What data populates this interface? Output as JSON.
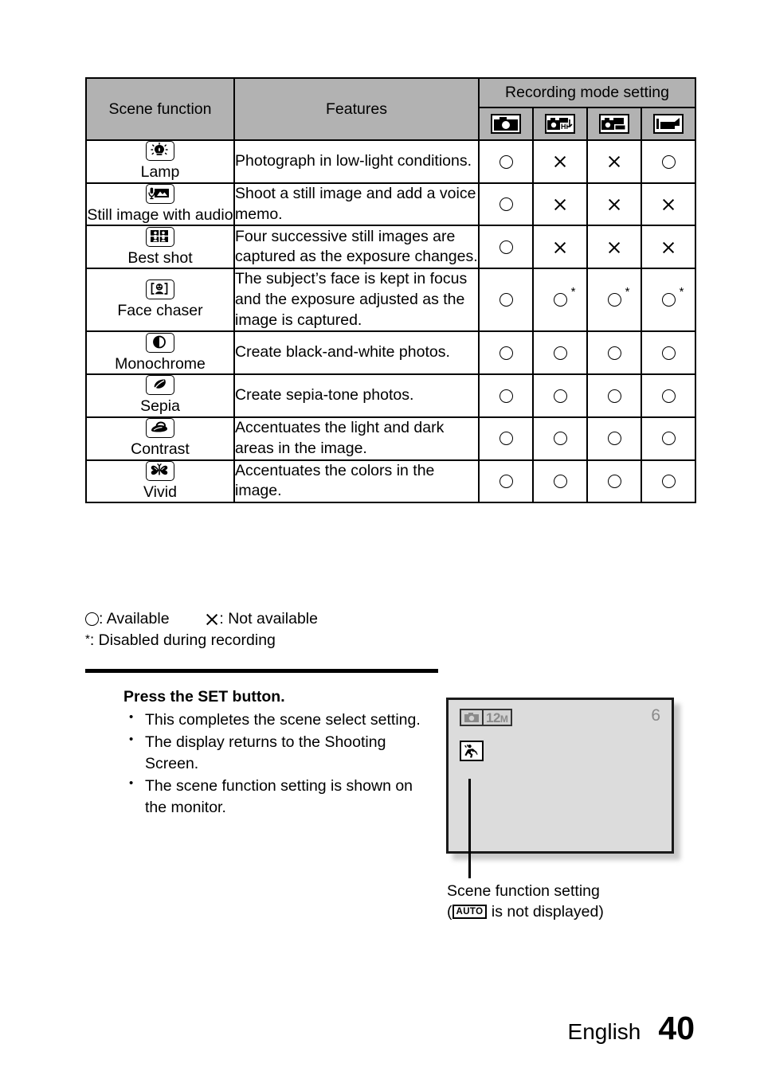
{
  "table": {
    "headers": {
      "scene_function": "Scene function",
      "features": "Features",
      "recording_mode_setting": "Recording mode setting"
    },
    "mode_icons": [
      {
        "name": "single-shot-camera-icon",
        "label": "single shot"
      },
      {
        "name": "high-speed-sequential-camera-icon",
        "label": "Hi sequential shots"
      },
      {
        "name": "sequential-shots-camera-icon",
        "label": "sequential shots"
      },
      {
        "name": "video-camera-icon",
        "label": "video"
      }
    ],
    "rows": [
      {
        "icon": "lamp-icon",
        "scene": "Lamp",
        "features": "Photograph in low-light conditions.",
        "marks": [
          "circle",
          "cross",
          "cross",
          "circle"
        ],
        "stars": [
          false,
          false,
          false,
          false
        ]
      },
      {
        "icon": "still-image-with-audio-icon",
        "scene": "Still image with audio",
        "features": "Shoot a still image and add a voice memo.",
        "marks": [
          "circle",
          "cross",
          "cross",
          "cross"
        ],
        "stars": [
          false,
          false,
          false,
          false
        ]
      },
      {
        "icon": "best-shot-icon",
        "scene": "Best shot",
        "features": "Four successive still images are captured as the exposure changes.",
        "marks": [
          "circle",
          "cross",
          "cross",
          "cross"
        ],
        "stars": [
          false,
          false,
          false,
          false
        ]
      },
      {
        "icon": "face-chaser-icon",
        "scene": "Face chaser",
        "features": "The subject’s face is kept in focus and the exposure adjusted as the image is captured.",
        "marks": [
          "circle",
          "circle",
          "circle",
          "circle"
        ],
        "stars": [
          false,
          true,
          true,
          true
        ]
      },
      {
        "icon": "monochrome-icon",
        "scene": "Monochrome",
        "features": "Create black-and-white photos.",
        "marks": [
          "circle",
          "circle",
          "circle",
          "circle"
        ],
        "stars": [
          false,
          false,
          false,
          false
        ]
      },
      {
        "icon": "sepia-icon",
        "scene": "Sepia",
        "features": "Create sepia-tone photos.",
        "marks": [
          "circle",
          "circle",
          "circle",
          "circle"
        ],
        "stars": [
          false,
          false,
          false,
          false
        ]
      },
      {
        "icon": "contrast-icon",
        "scene": "Contrast",
        "features": "Accentuates the light and dark areas in the image.",
        "marks": [
          "circle",
          "circle",
          "circle",
          "circle"
        ],
        "stars": [
          false,
          false,
          false,
          false
        ]
      },
      {
        "icon": "vivid-icon",
        "scene": "Vivid",
        "features": "Accentuates the colors in the image.",
        "marks": [
          "circle",
          "circle",
          "circle",
          "circle"
        ],
        "stars": [
          false,
          false,
          false,
          false
        ]
      }
    ]
  },
  "legend": {
    "available": ": Available",
    "not_available": ": Not available",
    "footnote_star": "*",
    "footnote_text": ":  Disabled during recording"
  },
  "instructions": {
    "title": "Press the SET button.",
    "bullets": [
      "This completes the scene select setting.",
      "The display returns to the Shooting Screen.",
      "The scene function setting is shown on the monitor."
    ]
  },
  "monitor": {
    "resolution": "12",
    "resolution_unit": "M",
    "remaining_count": "6",
    "scene_icon": "sports-running-figure-icon",
    "caption_line1": "Scene function setting",
    "caption_paren_open": "(",
    "auto_badge": "AUTO",
    "caption_line2_rest": "is not displayed)"
  },
  "footer": {
    "language": "English",
    "page_number": "40"
  },
  "colors": {
    "header_gray": "#b2b2b2",
    "monitor_screen": "#dcdcdc",
    "monitor_text_gray": "#8a8a8a"
  }
}
